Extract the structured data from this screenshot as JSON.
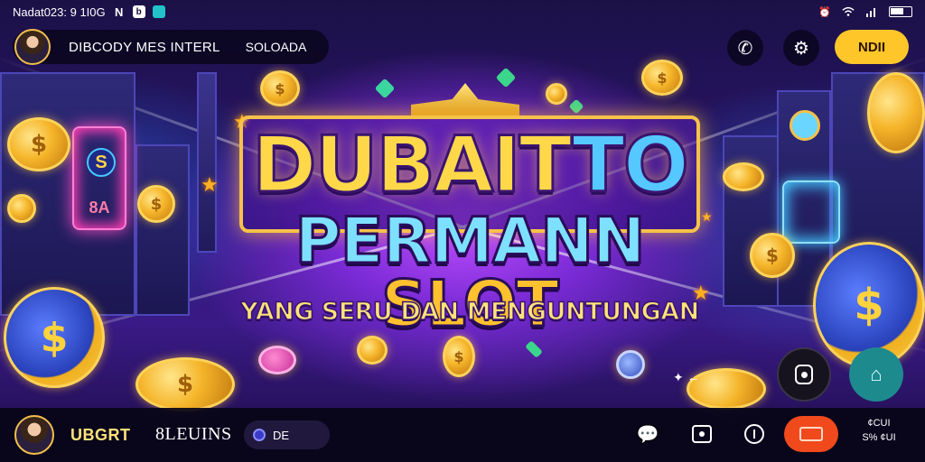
{
  "status_bar": {
    "left_text": "Nadat023: 9 1I0G",
    "icon_n": "N",
    "icon_b": "b",
    "icons": [
      "alarm-icon",
      "wifi-icon",
      "signal-icon",
      "battery-icon"
    ]
  },
  "top_bar": {
    "profile_name": "DIBCODY MES  INTERL",
    "profile_tag": "SOLOADA",
    "action_button_label": "NDII"
  },
  "banner": {
    "title_line1_gold": "DUBAIT",
    "title_line1_blue": "TO",
    "title_line2_blue": "PERMANN ",
    "title_line2_gold": "SLOT",
    "tagline": "YANG SERU DAN MENGUNTUNGAN"
  },
  "decor": {
    "coin_symbol": "$",
    "coin_symbol_small": "S",
    "sign_text": "8A",
    "small_label": "✦ ←"
  },
  "bottom_bar": {
    "player_name": "UBGRT",
    "coin_label": "8LEUINS",
    "pill_text": "DE",
    "stack_top": "¢CUI",
    "stack_bottom": "S% ¢UI"
  },
  "colors": {
    "accent_yellow": "#ffc629",
    "accent_red": "#f04a1c",
    "title_gold": "#ffd84a",
    "title_blue": "#55c8ff",
    "float_teal": "#1d8a8e"
  }
}
